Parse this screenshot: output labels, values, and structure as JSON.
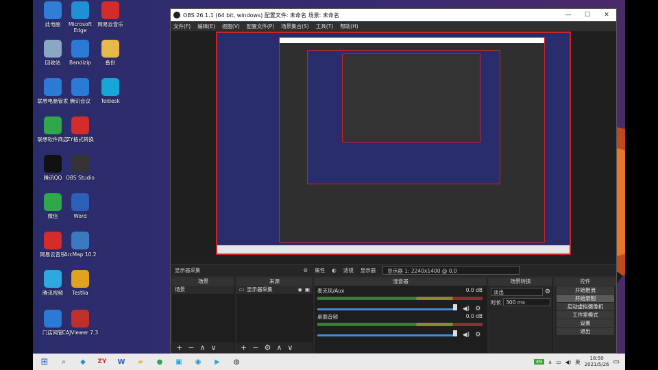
{
  "desktop_icons": [
    {
      "label": "此电脑",
      "icon": "computer-icon",
      "color": "#2f7fd8"
    },
    {
      "label": "Microsoft Edge",
      "icon": "edge-icon",
      "color": "#1f8fd6"
    },
    {
      "label": "网易云音乐",
      "icon": "netease-music-icon",
      "color": "#d42b2b"
    },
    {
      "label": "回收站",
      "icon": "recycle-bin-icon",
      "color": "#8aa7c4"
    },
    {
      "label": "Bandizip",
      "icon": "bandizip-icon",
      "color": "#2b7bd6"
    },
    {
      "label": "备份",
      "icon": "folder-icon",
      "color": "#e6b84a"
    },
    {
      "label": "联想电脑管家",
      "icon": "lenovo-manager-icon",
      "color": "#2b7bd6"
    },
    {
      "label": "腾讯会议",
      "icon": "tencent-meeting-icon",
      "color": "#2b7bd6"
    },
    {
      "label": "Teldesk",
      "icon": "teldesk-icon",
      "color": "#17a6d8"
    },
    {
      "label": "联想软件商店",
      "icon": "lenovo-store-icon",
      "color": "#2ea84a"
    },
    {
      "label": "ZY格式转换",
      "icon": "zy-icon",
      "color": "#d42b2b"
    },
    {
      "label": "腾讯QQ",
      "icon": "qq-icon",
      "color": "#111111"
    },
    {
      "label": "OBS Studio",
      "icon": "obs-icon",
      "color": "#333333"
    },
    {
      "label": "微信",
      "icon": "wechat-icon",
      "color": "#2ea84a"
    },
    {
      "label": "Word",
      "icon": "word-icon",
      "color": "#2b5fb8"
    },
    {
      "label": "网易云音乐",
      "icon": "netease-music-icon",
      "color": "#d42b2b"
    },
    {
      "label": "ArcMap 10.2",
      "icon": "arcmap-icon",
      "color": "#3a7ac0"
    },
    {
      "label": "腾讯视频",
      "icon": "tencent-video-icon",
      "color": "#2ea8e0"
    },
    {
      "label": "Testlia",
      "icon": "testlia-icon",
      "color": "#e0a020"
    },
    {
      "label": "门店网管",
      "icon": "store-icon",
      "color": "#2b7bd6"
    },
    {
      "label": "CAJViewer 7.3",
      "icon": "cajviewer-icon",
      "color": "#c0302a"
    }
  ],
  "obs": {
    "title": "OBS 26.1.1 (64 bit, windows)  配置文件: 未命名  场景: 未命名",
    "controls": [
      "—",
      "☐",
      "✕"
    ],
    "menu": [
      "文件(F)",
      "编辑(E)",
      "视图(V)",
      "配置文件(P)",
      "场景集合(S)",
      "工具(T)",
      "帮助(H)"
    ],
    "source_bar": {
      "left": "显示器采集",
      "properties": "属性",
      "filters": "滤镜",
      "display_label": "显示器",
      "display_value": "显示器 1: 2240x1400 @ 0,0"
    },
    "docks": {
      "scenes": {
        "title": "场景",
        "items": [
          "场景"
        ]
      },
      "sources": {
        "title": "来源",
        "items": [
          "显示器采集"
        ]
      },
      "mixer": {
        "title": "混音器",
        "tracks": [
          {
            "name": "麦克风/Aux",
            "db": "0.0 dB"
          },
          {
            "name": "桌面音频",
            "db": "0.0 dB"
          }
        ]
      },
      "transitions": {
        "title": "场景转换",
        "type": "淡出",
        "duration_label": "时长",
        "duration_value": "300 ms"
      },
      "controls": {
        "title": "控件",
        "buttons": [
          "开始推流",
          "开始录制",
          "启动虚拟摄像机",
          "工作室模式",
          "设置",
          "退出"
        ]
      }
    }
  },
  "taskbar": {
    "battery": "49",
    "tray_text": "英",
    "time": "18:50",
    "date": "2021/5/26"
  }
}
